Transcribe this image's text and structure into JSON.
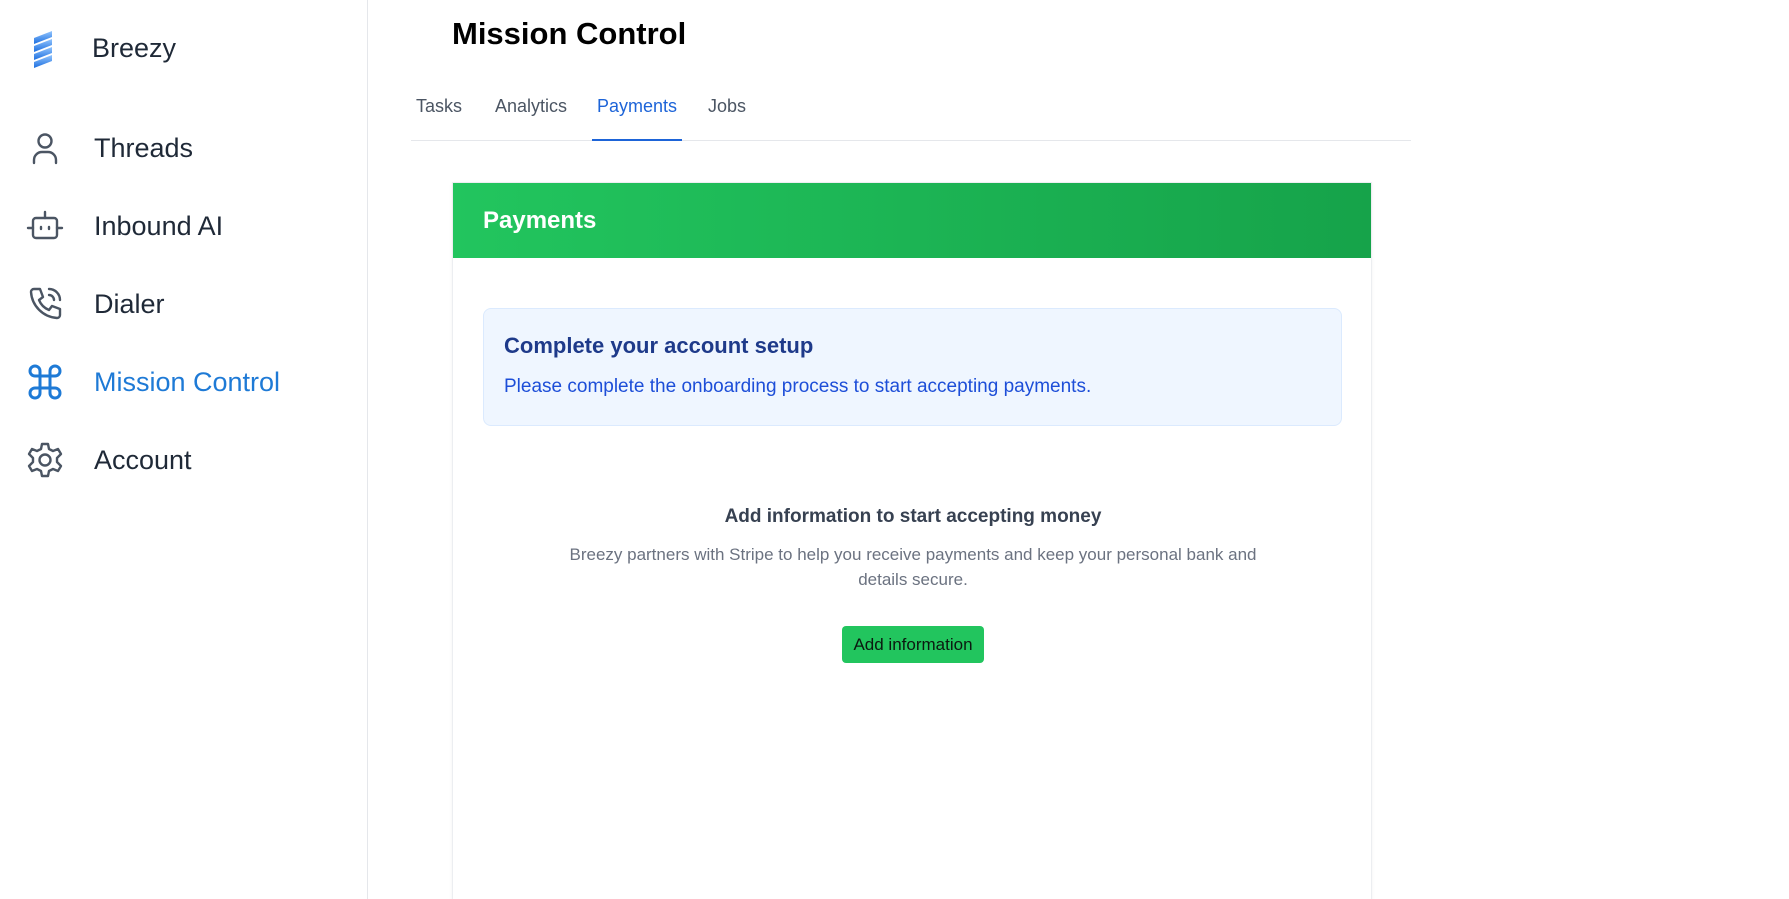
{
  "brand": {
    "name": "Breezy",
    "logo_icon": "breezy-logo-icon"
  },
  "sidebar": {
    "items": [
      {
        "label": "Threads",
        "icon": "user-icon",
        "active": false
      },
      {
        "label": "Inbound AI",
        "icon": "robot-icon",
        "active": false
      },
      {
        "label": "Dialer",
        "icon": "phone-icon",
        "active": false
      },
      {
        "label": "Mission Control",
        "icon": "command-icon",
        "active": true
      },
      {
        "label": "Account",
        "icon": "gear-icon",
        "active": false
      }
    ]
  },
  "page": {
    "title": "Mission Control"
  },
  "tabs": [
    {
      "label": "Tasks",
      "active": false
    },
    {
      "label": "Analytics",
      "active": false
    },
    {
      "label": "Payments",
      "active": true
    },
    {
      "label": "Jobs",
      "active": false
    }
  ],
  "payments": {
    "header_title": "Payments",
    "alert": {
      "title": "Complete your account setup",
      "message": "Please complete the onboarding process to start accepting payments."
    },
    "empty": {
      "heading": "Add information to start accepting money",
      "description": "Breezy partners with Stripe to help you receive payments and keep your personal bank and details secure.",
      "button_label": "Add information"
    }
  },
  "colors": {
    "accent": "#1e7ad6",
    "tab_active": "#1d64d8",
    "success": "#22c55e",
    "alert_bg": "#eff6ff",
    "alert_title": "#1e3a8a"
  }
}
